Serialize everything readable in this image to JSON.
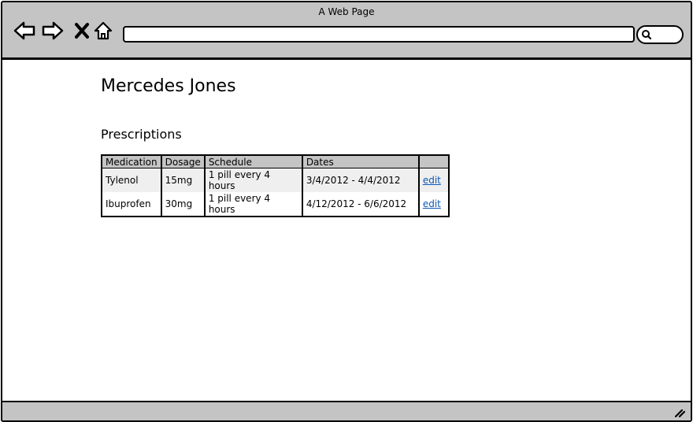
{
  "window": {
    "title": "A Web Page"
  },
  "browser": {
    "address": "",
    "icons": [
      "back-icon",
      "forward-icon",
      "close-icon",
      "home-icon",
      "search-icon",
      "resize-handle-icon"
    ]
  },
  "page": {
    "patient_name": "Mercedes Jones",
    "section_title": "Prescriptions"
  },
  "table": {
    "headers": [
      "Medication",
      "Dosage",
      "Schedule",
      "Dates",
      ""
    ],
    "rows": [
      {
        "medication": "Tylenol",
        "dosage": "15mg",
        "schedule": "1 pill every 4 hours",
        "dates": "3/4/2012 - 4/4/2012",
        "action": "edit"
      },
      {
        "medication": "Ibuprofen",
        "dosage": "30mg",
        "schedule": "1 pill every 4 hours",
        "dates": "4/12/2012 - 6/6/2012",
        "action": "edit"
      }
    ]
  },
  "colors": {
    "chrome": "#c4c4c4",
    "link": "#0b58b5",
    "stripe": "#efefef"
  }
}
